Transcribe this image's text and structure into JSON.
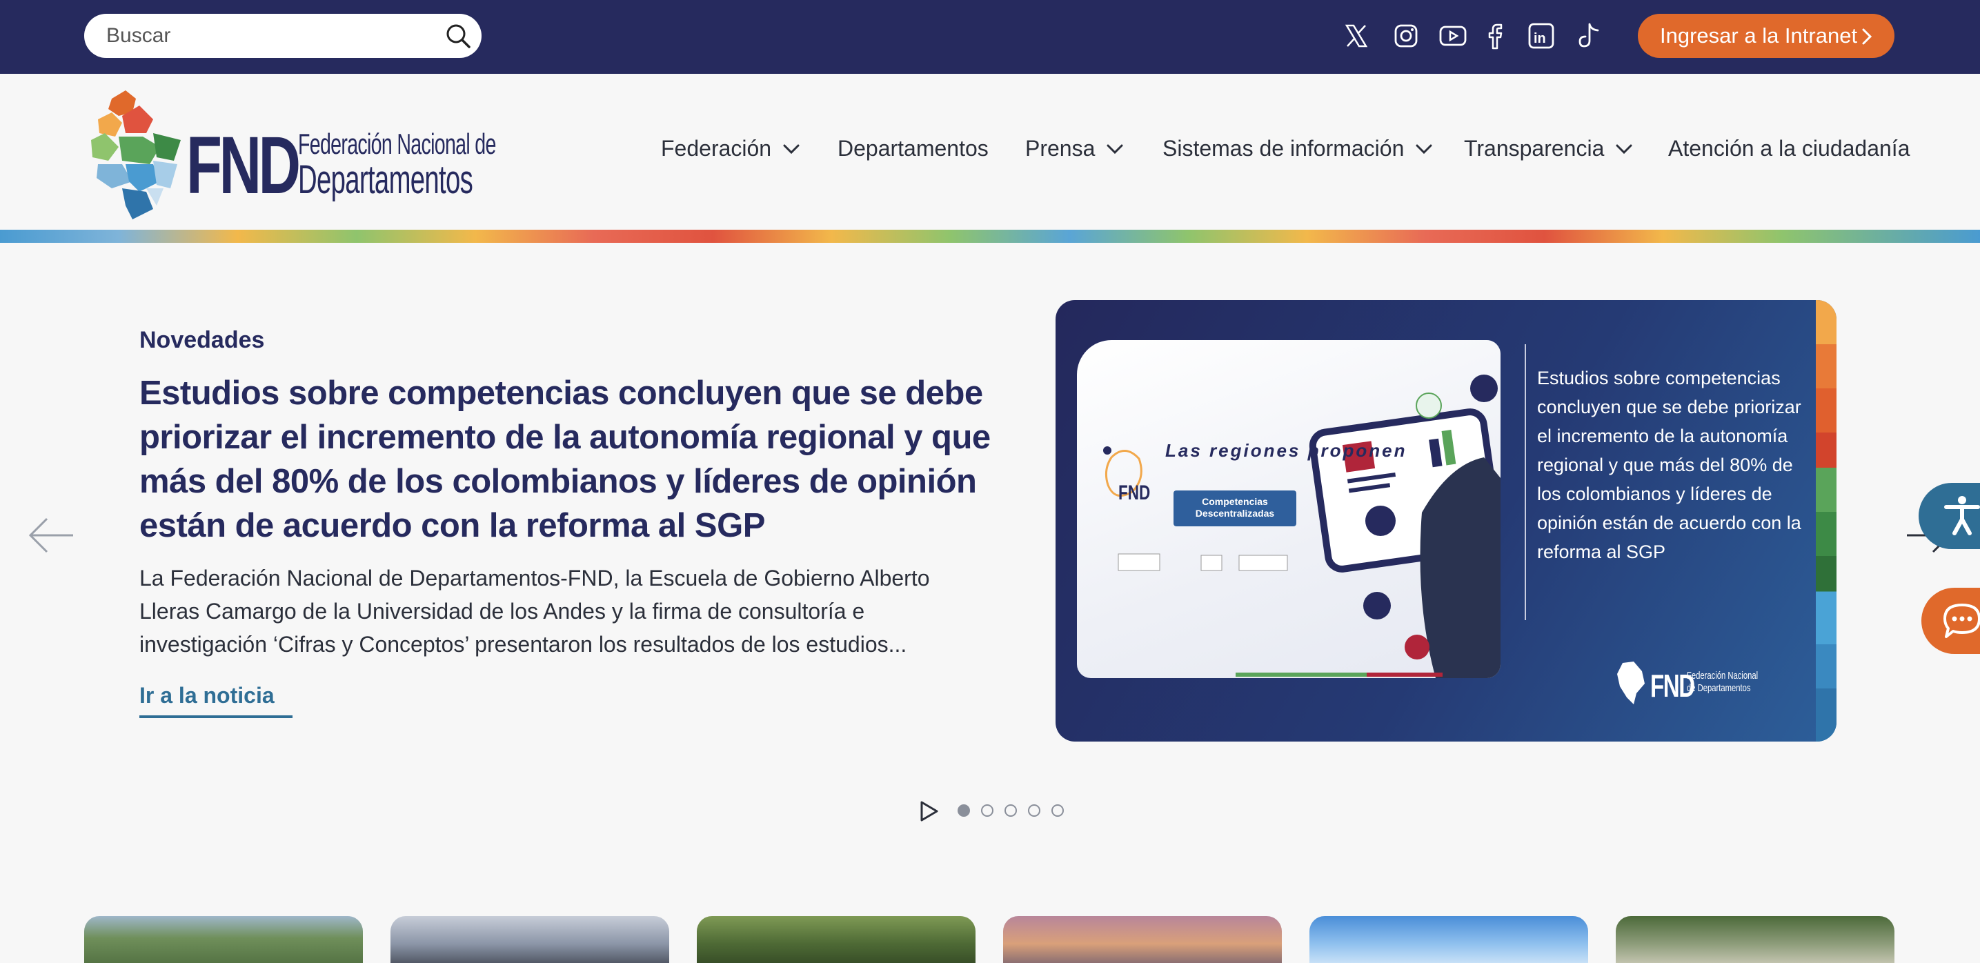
{
  "search": {
    "placeholder": "Buscar"
  },
  "social": [
    "x-icon",
    "instagram-icon",
    "youtube-icon",
    "facebook-icon",
    "linkedin-icon",
    "tiktok-icon"
  ],
  "intranet": {
    "label": "Ingresar a la Intranet"
  },
  "logo": {
    "acronym": "FND",
    "line1": "Federación Nacional de",
    "line2": "Departamentos"
  },
  "nav": {
    "items": [
      {
        "label": "Federación",
        "dropdown": true
      },
      {
        "label": "Departamentos",
        "dropdown": false
      },
      {
        "label": "Prensa",
        "dropdown": true
      },
      {
        "label": "Sistemas de información",
        "dropdown": true
      },
      {
        "label": "Transparencia",
        "dropdown": true
      },
      {
        "label": "Atención a la ciudadanía",
        "dropdown": false
      }
    ]
  },
  "hero": {
    "kicker": "Novedades",
    "headline": "Estudios sobre competencias concluyen que se debe priorizar el incremento de la autonomía regional y que más del 80% de los colombianos y líderes de opinión están de acuerdo con la reforma al SGP",
    "summary": "La Federación Nacional de Departamentos-FND, la Escuela de Gobierno Alberto Lleras Camargo de la Universidad de los Andes y la firma de consultoría e investigación ‘Cifras y Conceptos’ presentaron los resultados de los estudios...",
    "cta": "Ir a la noticia"
  },
  "banner": {
    "text": "Estudios sobre competencias concluyen que se debe priorizar el incremento de la autonomía regional y que más del 80% de los colombianos y líderes de opinión están de acuerdo con la reforma al SGP",
    "card_title": "Las regiones proponen",
    "card_badge": "Competencias Descentralizadas",
    "card_fnd": "FND",
    "logo_acronym": "FND",
    "logo_sub": "Federación Nacional de Departamentos"
  },
  "carousel": {
    "slides": 5,
    "active": 0
  },
  "colors": {
    "navy": "#262a5e",
    "orange": "#e0692b",
    "teal": "#2f6e95",
    "background": "#f7f7f7"
  }
}
